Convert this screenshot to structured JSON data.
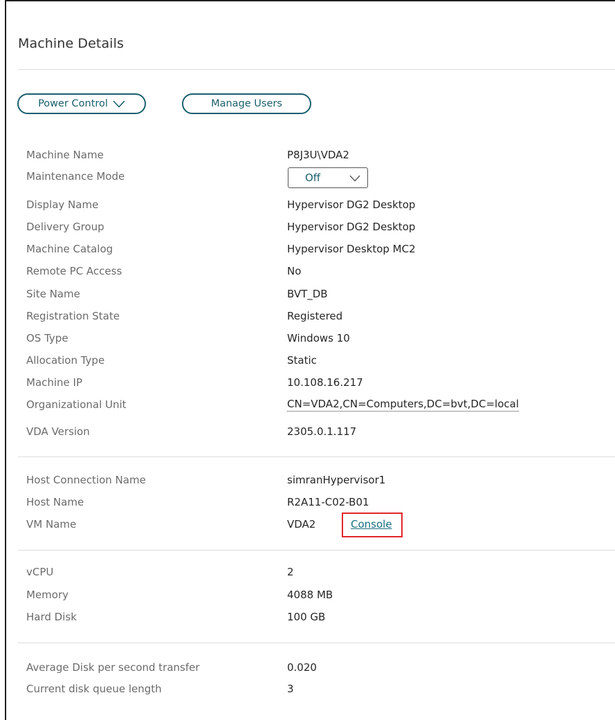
{
  "panel": {
    "title": "Machine Details"
  },
  "actions": {
    "power_control_label": "Power Control",
    "manage_users_label": "Manage Users",
    "power_control_icon": "chevron-down-icon"
  },
  "details": {
    "machine_name": {
      "label": "Machine Name",
      "value": "P8J3U\\VDA2"
    },
    "maintenance_mode": {
      "label": "Maintenance Mode",
      "value": "Off"
    },
    "display_name": {
      "label": "Display Name",
      "value": "Hypervisor DG2 Desktop"
    },
    "delivery_group": {
      "label": "Delivery Group",
      "value": "Hypervisor DG2 Desktop"
    },
    "machine_catalog": {
      "label": "Machine Catalog",
      "value": "Hypervisor Desktop MC2"
    },
    "remote_pc_access": {
      "label": "Remote PC Access",
      "value": "No"
    },
    "site_name": {
      "label": "Site Name",
      "value": "BVT_DB"
    },
    "registration_state": {
      "label": "Registration State",
      "value": "Registered"
    },
    "os_type": {
      "label": "OS Type",
      "value": "Windows 10"
    },
    "allocation_type": {
      "label": "Allocation Type",
      "value": "Static"
    },
    "machine_ip": {
      "label": "Machine IP",
      "value": "10.108.16.217"
    },
    "organizational_unit": {
      "label": "Organizational Unit",
      "value": "CN=VDA2,CN=Computers,DC=bvt,DC=local"
    },
    "vda_version": {
      "label": "VDA Version",
      "value": "2305.0.1.117"
    }
  },
  "host": {
    "host_connection_name": {
      "label": "Host Connection Name",
      "value": "simranHypervisor1"
    },
    "host_name": {
      "label": "Host Name",
      "value": "R2A11-C02-B01"
    },
    "vm_name": {
      "label": "VM Name",
      "value": "VDA2",
      "console_link": "Console"
    }
  },
  "resources": {
    "vcpu": {
      "label": "vCPU",
      "value": "2"
    },
    "memory": {
      "label": "Memory",
      "value": "4088 MB"
    },
    "hard_disk": {
      "label": "Hard Disk",
      "value": "100 GB"
    }
  },
  "disk": {
    "avg_disk_transfer": {
      "label": "Average Disk per second transfer",
      "value": "0.020"
    },
    "disk_queue_length": {
      "label": "Current disk queue length",
      "value": "3"
    }
  },
  "colors": {
    "accent": "#1a5f6d",
    "highlight_box": "#e0262a"
  }
}
